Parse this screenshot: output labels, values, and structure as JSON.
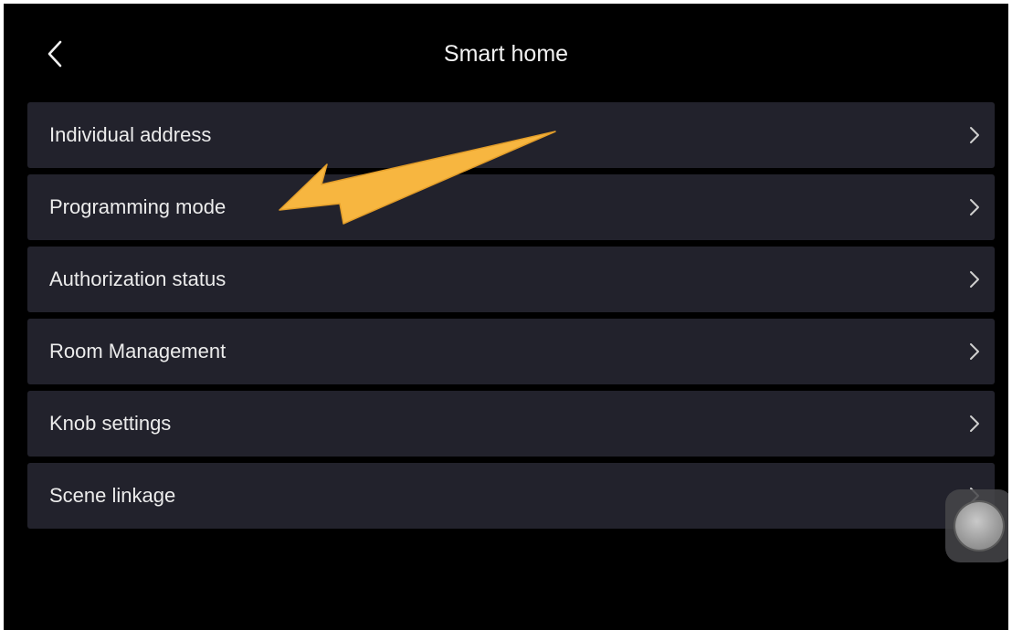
{
  "header": {
    "title": "Smart home",
    "back_icon": "chevron-left-icon"
  },
  "menu": {
    "items": [
      {
        "label": "Individual address",
        "icon": "chevron-right-icon"
      },
      {
        "label": "Programming mode",
        "icon": "chevron-right-icon"
      },
      {
        "label": "Authorization status",
        "icon": "chevron-right-icon"
      },
      {
        "label": "Room Management",
        "icon": "chevron-right-icon"
      },
      {
        "label": "Knob settings",
        "icon": "chevron-right-icon"
      },
      {
        "label": "Scene linkage",
        "icon": "chevron-right-icon"
      }
    ]
  },
  "annotation": {
    "arrow_color": "#f7b640",
    "points_to": "Programming mode"
  },
  "floating_ball": {
    "icon": "assistive-touch-icon"
  },
  "colors": {
    "background": "#000000",
    "row_background": "#22222c",
    "text": "#ececec"
  }
}
